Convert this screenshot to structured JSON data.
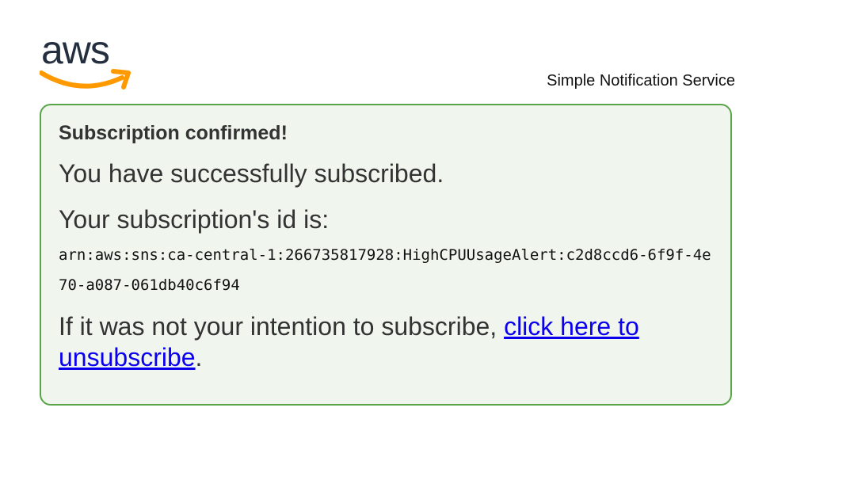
{
  "header": {
    "logo_text": "aws",
    "service_name": "Simple Notification Service"
  },
  "card": {
    "title": "Subscription confirmed!",
    "success_message": "You have successfully subscribed.",
    "id_label": "Your subscription's id is:",
    "subscription_arn": "arn:aws:sns:ca-central-1:266735817928:HighCPUUsageAlert:c2d8ccd6-6f9f-4e70-a087-061db40c6f94",
    "unsubscribe_prefix": "If it was not your intention to subscribe, ",
    "unsubscribe_link": "click here to unsubscribe",
    "unsubscribe_suffix": "."
  },
  "colors": {
    "card_border": "#58a448",
    "card_background": "#f0f5ee",
    "link": "#0a00ee",
    "logo_smile": "#f90",
    "logo_text": "#232f3e"
  }
}
